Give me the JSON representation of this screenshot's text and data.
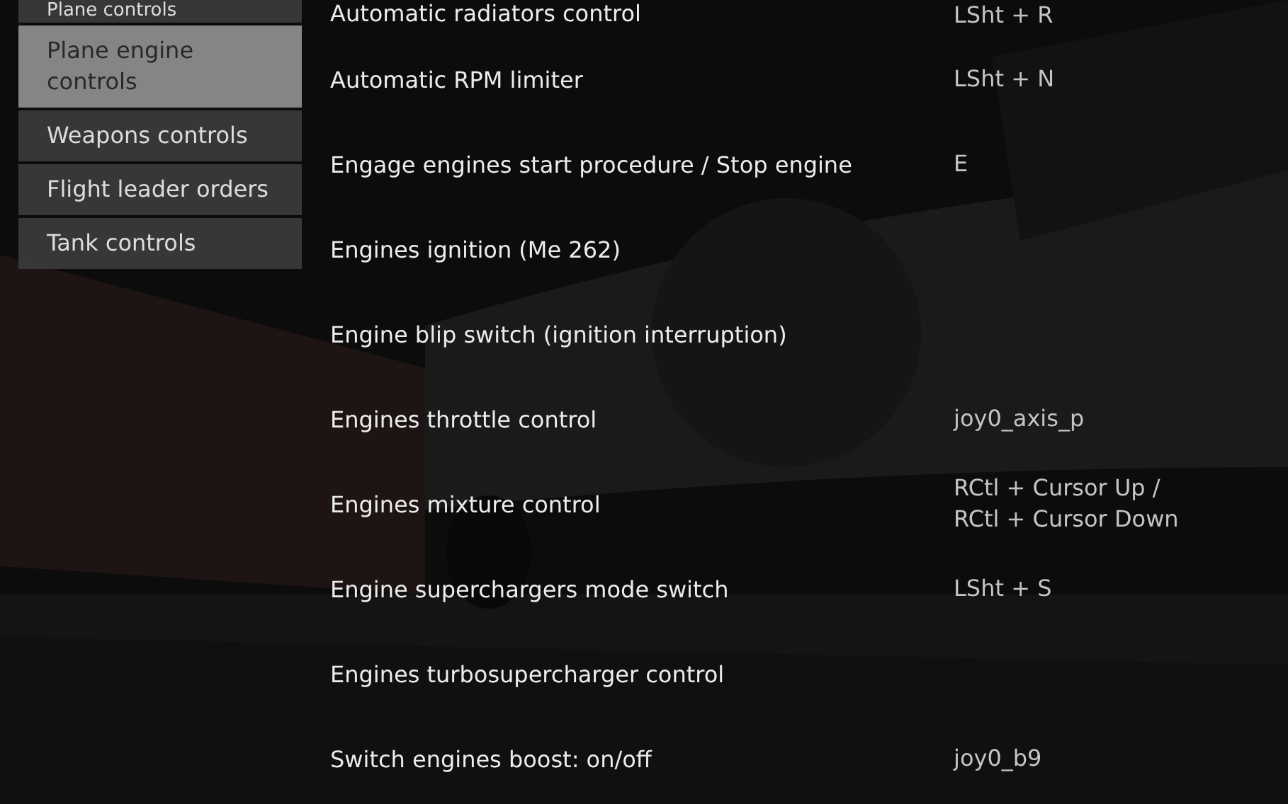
{
  "sidebar": {
    "items": [
      {
        "label": "Plane controls",
        "selected": false
      },
      {
        "label": "Plane engine controls",
        "selected": true
      },
      {
        "label": "Weapons controls",
        "selected": false
      },
      {
        "label": "Flight leader orders",
        "selected": false
      },
      {
        "label": "Tank controls",
        "selected": false
      }
    ]
  },
  "bindings": [
    {
      "action": "Automatic radiators control",
      "key": "LSht + R"
    },
    {
      "action": "Automatic RPM limiter",
      "key": "LSht + N"
    },
    {
      "action": "Engage engines start procedure / Stop engine",
      "key": "E"
    },
    {
      "action": "Engines ignition (Me 262)"
    },
    {
      "action": "Engine blip switch (ignition interruption)"
    },
    {
      "action": "Engines throttle control",
      "key": "joy0_axis_p"
    },
    {
      "action": "Engines mixture control",
      "key": "RCtl + Cursor Up /\nRCtl + Cursor Down"
    },
    {
      "action": "Engine superchargers mode switch",
      "key": "LSht + S"
    },
    {
      "action": "Engines turbosupercharger control"
    },
    {
      "action": "Switch engines boost: on/off",
      "key": "joy0_b9"
    }
  ]
}
